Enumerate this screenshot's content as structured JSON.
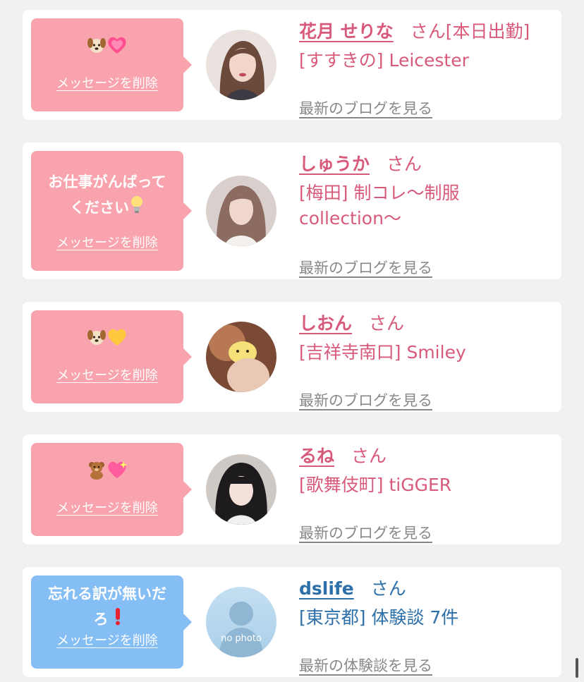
{
  "colors": {
    "background": "#f1f1f1",
    "pink_bubble": "#f8a3ad",
    "blue_bubble": "#85bdf5",
    "pink_text": "#d85a7a",
    "blue_text": "#2d6fa8",
    "blog_link": "#888888"
  },
  "messages": [
    {
      "bubble_text": "",
      "bubble_emojis": [
        "puppy-face",
        "growing-heart"
      ],
      "delete_label": "メッセージを削除",
      "name": "花月 せりな",
      "honorific": "さん[本日出勤]",
      "shop": "[すすきの] Leicester",
      "blog_label": "最新のブログを見る"
    },
    {
      "bubble_text_line1": "お仕事がんばって",
      "bubble_text_line2": "ください",
      "bubble_emojis": [
        "light-bulb"
      ],
      "delete_label": "メッセージを削除",
      "name": "しゅうか",
      "honorific": "さん",
      "shop": "[梅田] 制コレ〜制服collection〜",
      "blog_label": "最新のブログを見る"
    },
    {
      "bubble_text": "",
      "bubble_emojis": [
        "puppy-face",
        "yellow-heart"
      ],
      "delete_label": "メッセージを削除",
      "name": "しおん",
      "honorific": "さん",
      "shop": "[吉祥寺南口] Smiley",
      "blog_label": "最新のブログを見る"
    },
    {
      "bubble_text": "",
      "bubble_emojis": [
        "teddy-bear",
        "sparkling-heart"
      ],
      "delete_label": "メッセージを削除",
      "name": "るね",
      "honorific": "さん",
      "shop": "[歌舞伎町] tiGGER",
      "blog_label": "最新のブログを見る"
    },
    {
      "bubble_text_line1": "忘れる訳が無いだ",
      "bubble_text_line2": "ろ",
      "bubble_emojis": [
        "exclamation-mark"
      ],
      "delete_label": "メッセージを削除",
      "name": "dslife",
      "honorific": "さん",
      "shop": "[東京都] 体験談 7件",
      "avatar_text": "no photo",
      "blog_label": "最新の体験談を見る"
    }
  ]
}
